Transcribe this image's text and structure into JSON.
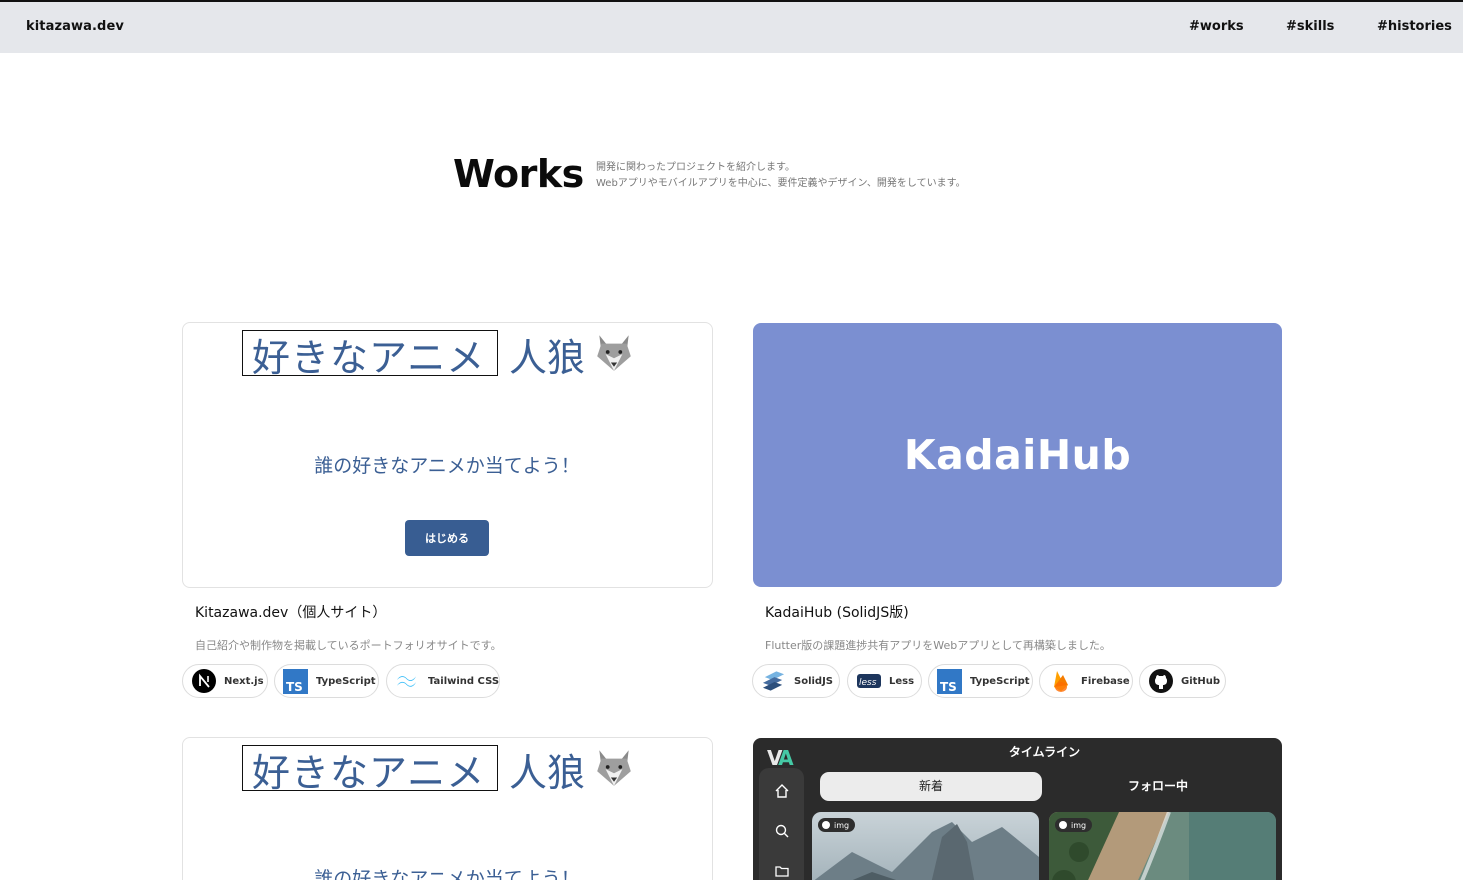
{
  "nav": {
    "brand": "kitazawa.dev",
    "links": [
      "#works",
      "#skills",
      "#histories"
    ]
  },
  "works": {
    "title": "Works",
    "desc_line1": "開発に関わったプロジェクトを紹介します。",
    "desc_line2": "Webアプリやモバイルアプリを中心に、要件定義やデザイン、開発をしています。"
  },
  "cards": [
    {
      "preview": {
        "title_boxed": "好きなアニメ",
        "title_after": "人狼",
        "subtitle": "誰の好きなアニメか当てよう！",
        "button": "はじめる"
      },
      "title": "Kitazawa.dev（個人サイト）",
      "description": "自己紹介や制作物を掲載しているポートフォリオサイトです。",
      "tags": [
        "Next.js",
        "TypeScript",
        "Tailwind CSS"
      ]
    },
    {
      "preview": {
        "logo_text": "KadaiHub"
      },
      "title": "KadaiHub (SolidJS版)",
      "description": "Flutter版の課題進捗共有アプリをWebアプリとして再構築しました。",
      "tags": [
        "SolidJS",
        "Less",
        "TypeScript",
        "Firebase",
        "GitHub"
      ]
    },
    {
      "preview": {
        "title_boxed": "好きなアニメ",
        "title_after": "人狼",
        "subtitle": "誰の好きなアニメか当てよう！"
      }
    },
    {
      "preview": {
        "logo_v": "V",
        "logo_a": "A",
        "header": "タイムライン",
        "tab_new": "新着",
        "tab_follow": "フォロー中",
        "badge": "img"
      }
    }
  ],
  "colors": {
    "nav_bg": "#e5e7eb",
    "anime_blue": "#3b5f94",
    "kadai_bg": "#7b8fd1",
    "timeline_bg": "#2b2b2b"
  }
}
